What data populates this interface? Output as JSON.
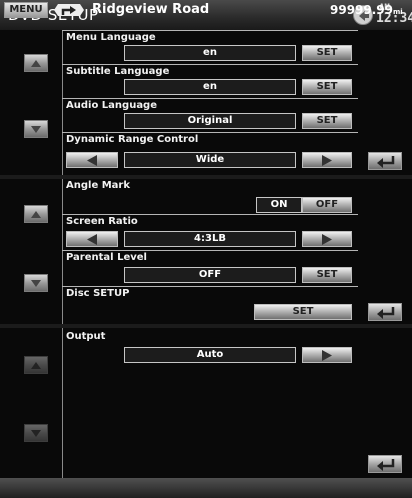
{
  "header": {
    "title": "DVD SETUP",
    "ampm": "AM",
    "clock": "12:34"
  },
  "panel1": {
    "rows": [
      {
        "label": "Menu Language",
        "value": "en",
        "button": "SET"
      },
      {
        "label": "Subtitle Language",
        "value": "en",
        "button": "SET"
      },
      {
        "label": "Audio Language",
        "value": "Original",
        "button": "SET"
      },
      {
        "label": "Dynamic Range Control",
        "value": "Wide"
      }
    ]
  },
  "panel2": {
    "angle_mark": {
      "label": "Angle Mark",
      "on": "ON",
      "off": "OFF"
    },
    "screen_ratio": {
      "label": "Screen Ratio",
      "value": "4:3LB"
    },
    "parental_level": {
      "label": "Parental Level",
      "value": "OFF",
      "button": "SET"
    },
    "disc_setup": {
      "label": "Disc SETUP",
      "button": "SET"
    }
  },
  "panel3": {
    "output": {
      "label": "Output",
      "value": "Auto"
    }
  },
  "footer": {
    "menu": "MENU",
    "street": "Ridgeview Road",
    "distance": "99999.99",
    "unit": "mi"
  },
  "icons": [
    "back-icon",
    "scroll-up-icon",
    "scroll-down-icon",
    "return-icon",
    "left-arrow-icon",
    "right-arrow-icon",
    "turn-right-icon"
  ]
}
